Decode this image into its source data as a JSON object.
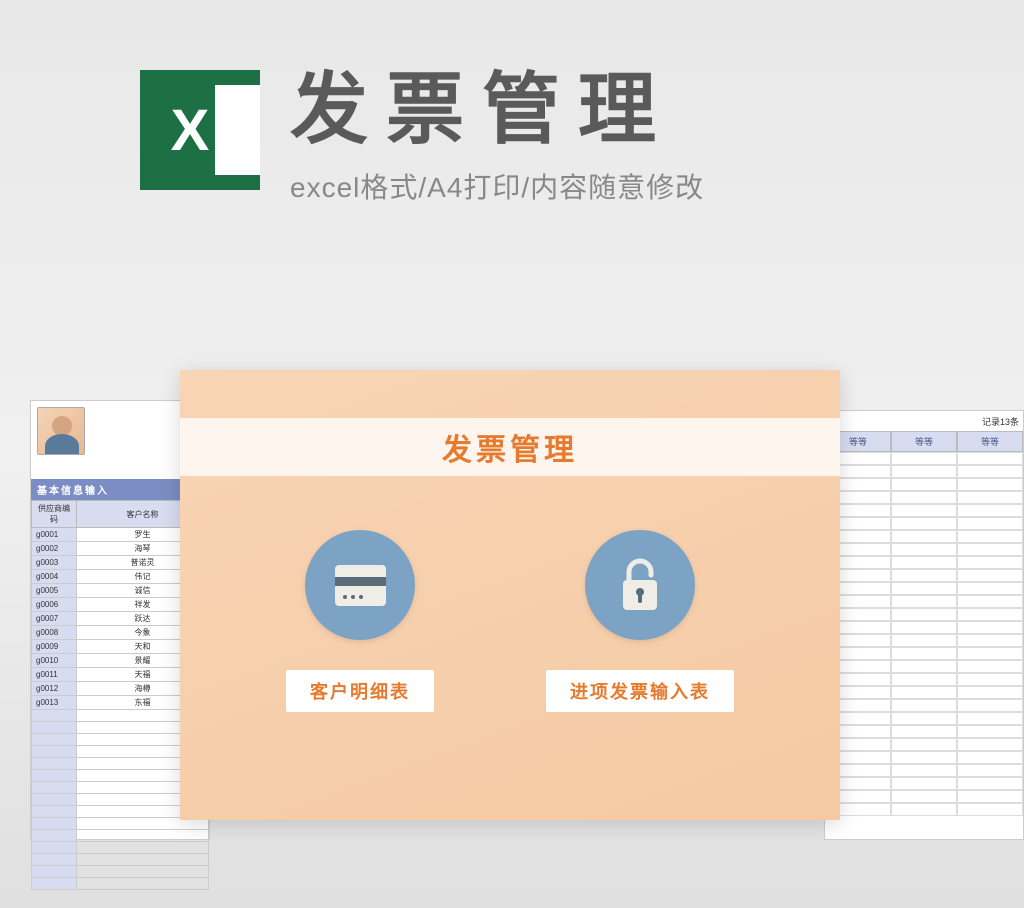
{
  "header": {
    "title": "发票管理",
    "subtitle": "excel格式/A4打印/内容随意修改",
    "excel_letter": "X"
  },
  "left_sheet": {
    "section_title": "基本信息输入",
    "columns": [
      "供应商编码",
      "客户名称"
    ],
    "rows": [
      {
        "code": "g0001",
        "name": "罗生"
      },
      {
        "code": "g0002",
        "name": "海琴"
      },
      {
        "code": "g0003",
        "name": "普诺灵"
      },
      {
        "code": "g0004",
        "name": "伟记"
      },
      {
        "code": "g0005",
        "name": "诚信"
      },
      {
        "code": "g0006",
        "name": "祥发"
      },
      {
        "code": "g0007",
        "name": "跃达"
      },
      {
        "code": "g0008",
        "name": "今象"
      },
      {
        "code": "g0009",
        "name": "天和"
      },
      {
        "code": "g0010",
        "name": "景耀"
      },
      {
        "code": "g0011",
        "name": "天福"
      },
      {
        "code": "g0012",
        "name": "海樽"
      },
      {
        "code": "g0013",
        "name": "东福"
      }
    ]
  },
  "right_sheet": {
    "note": "记录13条",
    "headers": [
      "等等",
      "等等",
      "等等"
    ]
  },
  "card": {
    "title": "发票管理",
    "buttons": [
      {
        "label": "客户明细表",
        "icon": "card-icon"
      },
      {
        "label": "进项发票输入表",
        "icon": "lock-icon"
      }
    ]
  }
}
